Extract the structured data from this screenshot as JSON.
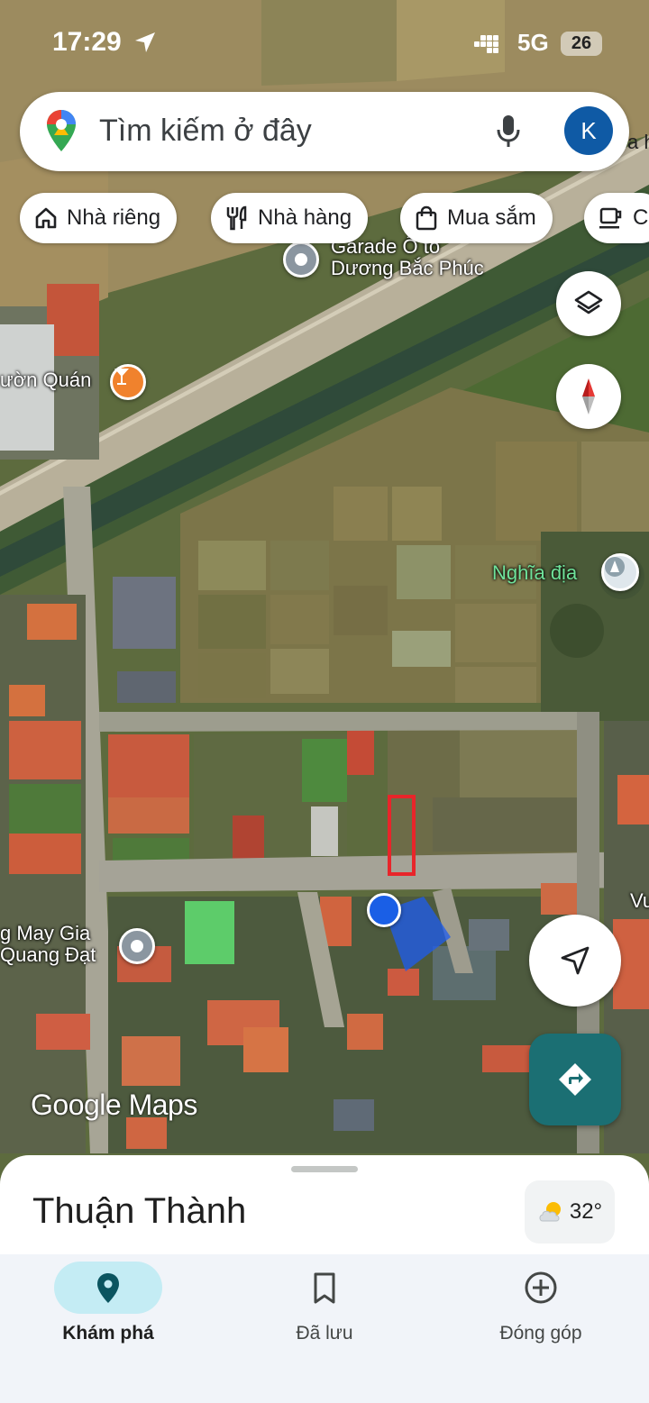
{
  "status_bar": {
    "time": "17:29",
    "network": "5G",
    "battery": "26"
  },
  "search": {
    "placeholder": "Tìm kiếm ở đây",
    "avatar_letter": "K"
  },
  "chips": [
    {
      "label": "Nhà riêng",
      "icon": "home-icon"
    },
    {
      "label": "Nhà hàng",
      "icon": "restaurant-icon"
    },
    {
      "label": "Mua sắm",
      "icon": "shopping-bag-icon"
    },
    {
      "label": "C",
      "icon": "coffee-icon"
    }
  ],
  "map_labels": {
    "garage": "Garade Ô tô\nDương Bắc Phúc",
    "garage_line1": "Garade Ô tô",
    "garage_line2": "Dương Bắc Phúc",
    "vuon_quan": "ườn Quán",
    "nghia_dia": "Nghĩa địa",
    "may_gia_line1": "g May Gia",
    "may_gia_line2": "Quang Đạt",
    "vu": "Vu",
    "top_right_fragment": "a h"
  },
  "logo": {
    "google": "Google",
    "maps": "Maps"
  },
  "sheet": {
    "title": "Thuận Thành",
    "temperature": "32°"
  },
  "bottom_nav": [
    {
      "label": "Khám phá",
      "icon": "explore-pin-icon",
      "active": true
    },
    {
      "label": "Đã lưu",
      "icon": "bookmark-icon",
      "active": false
    },
    {
      "label": "Đóng góp",
      "icon": "add-circle-icon",
      "active": false
    }
  ],
  "colors": {
    "user_dot": "#1a5fe6",
    "selection_rect": "#e8252a",
    "directions_fab": "#1b6f73",
    "nav_active_pill": "#c4ecf4",
    "avatar": "#0f5aa5"
  }
}
